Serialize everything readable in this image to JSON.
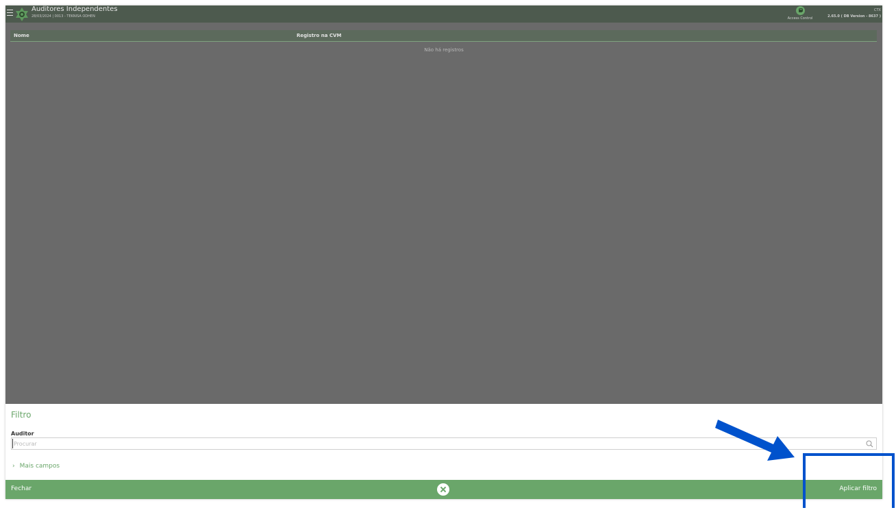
{
  "header": {
    "title": "Auditores Independentes",
    "subtitle": "28/03/2024 | 0013 - TEKNISA ODHEN",
    "access_label": "Access Control",
    "env": "CTX",
    "version": "2.65.0 ( DB Version - 8637 )"
  },
  "grid": {
    "columns": [
      "Nome",
      "Registro na CVM"
    ],
    "empty_message": "Não há registros"
  },
  "filter": {
    "title": "Filtro",
    "field_label": "Auditor",
    "placeholder": "Procurar",
    "more_fields": "Mais campos"
  },
  "footer": {
    "close_label": "Fechar",
    "apply_label": "Aplicar filtro"
  },
  "colors": {
    "accent": "#6aa66a",
    "header_bg": "#4d5a4e",
    "overlay_bg": "#6a6a6a",
    "annotation": "#0052cc"
  }
}
